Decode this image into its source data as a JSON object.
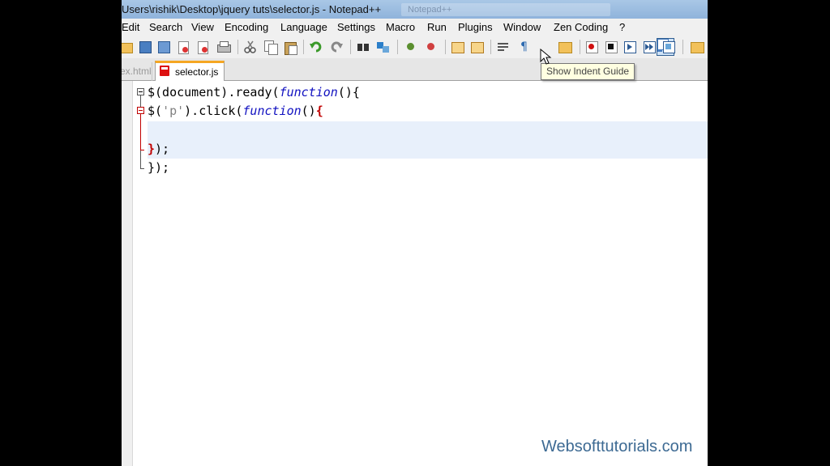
{
  "window": {
    "title": "Users\\rishik\\Desktop\\jquery tuts\\selector.js - Notepad++",
    "ghost_title": "Notepad++"
  },
  "menu": [
    "Edit",
    "Search",
    "View",
    "Encoding",
    "Language",
    "Settings",
    "Macro",
    "Run",
    "Plugins",
    "Window",
    "Zen Coding",
    "?"
  ],
  "toolbar": {
    "tooltip": "Show Indent Guide",
    "pressed_button": "show-indent-guide"
  },
  "tabs": [
    {
      "label": "ex.html",
      "active": false
    },
    {
      "label": "selector.js",
      "active": true
    }
  ],
  "code": {
    "line1": {
      "pre": "$(document).ready(",
      "kw": "function",
      "post": "(){"
    },
    "line2": {
      "pre": "$(",
      "str": "'p'",
      "mid": ").click(",
      "kw": "function",
      "post": "()",
      "brace": "{"
    },
    "line4": {
      "brace": "}",
      "post": ");"
    },
    "line5": {
      "post": "});"
    }
  },
  "watermark": "Websofttutorials.com",
  "colors": {
    "keyword": "#1010c0",
    "brace_highlight": "#c00000",
    "tab_accent": "#f5a623",
    "watermark": "#3d6a93"
  }
}
